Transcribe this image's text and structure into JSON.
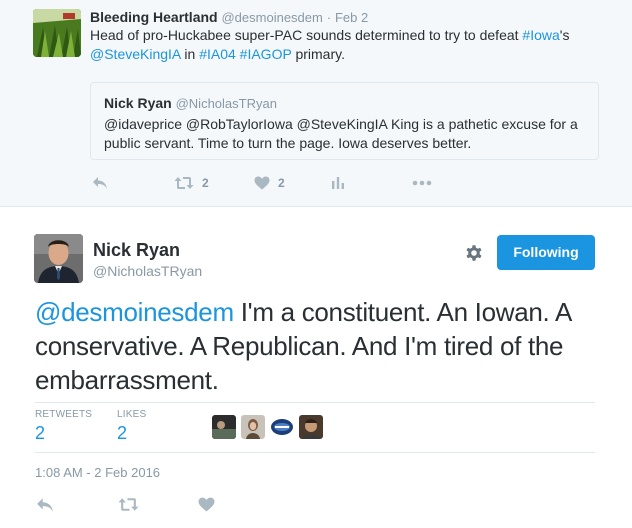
{
  "parent_tweet": {
    "author_name": "Bleeding Heartland",
    "author_handle": "@desmoinesdem",
    "separator": "·",
    "date": "Feb 2",
    "text_before": "Head of pro-Huckabee super-PAC sounds determined to try to defeat ",
    "hashtag_iowa": "#Iowa",
    "text_apostrophe": "'s",
    "mention_king": "@SteveKingIA",
    "text_in": " in ",
    "hashtag_ia04": "#IA04",
    "hashtag_iagop": "#IAGOP",
    "text_end": " primary.",
    "quoted": {
      "author_name": "Nick Ryan",
      "author_handle": "@NicholasTRyan",
      "text": "@idaveprice @RobTaylorIowa @SteveKingIA King is a pathetic excuse for a public servant. Time to turn the page. Iowa deserves better."
    },
    "retweet_count": "2",
    "like_count": "2"
  },
  "main_tweet": {
    "author_name": "Nick Ryan",
    "author_handle": "@NicholasTRyan",
    "follow_label": "Following",
    "mention": "@desmoinesdem",
    "text": " I'm a constituent. An Iowan. A conservative. A Republican. And I'm tired of the embarrassment.",
    "retweets_label": "RETWEETS",
    "retweets_count": "2",
    "likes_label": "LIKES",
    "likes_count": "2",
    "timestamp": "1:08 AM - 2 Feb 2016"
  },
  "colors": {
    "link": "#1b95e0",
    "muted": "#8899a6",
    "action_icon": "#aab8c2",
    "text": "#292f33",
    "parent_bg": "#f5f8fa"
  },
  "icons": {
    "reply": "reply-icon",
    "retweet": "retweet-icon",
    "like": "heart-icon",
    "analytics": "analytics-icon",
    "more": "more-icon",
    "settings": "gear-icon"
  }
}
